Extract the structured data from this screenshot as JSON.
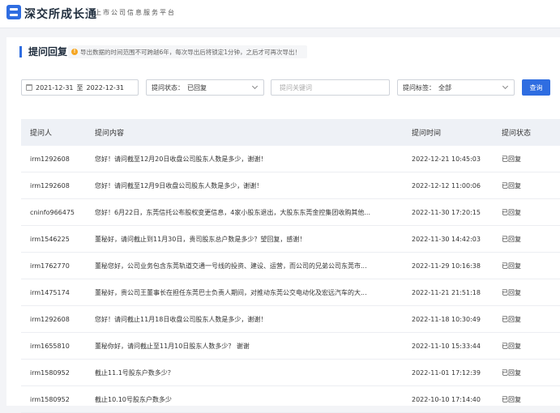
{
  "header": {
    "brand": "深交所成长通",
    "slogan": "上市公司信息服务平台"
  },
  "section": {
    "title": "提问回复",
    "notice": "导出数据的时间范围不可跨越6年，每次导出后将锁定1分钟，之后才可再次导出！"
  },
  "filters": {
    "date_start": "2021-12-31",
    "date_sep": "至",
    "date_end": "2022-12-31",
    "status_label": "提问状态：",
    "status_value": "已回复",
    "keyword_placeholder": "提问关键词",
    "tag_label": "提问标签：",
    "tag_value": "全部",
    "query_button": "查询"
  },
  "table": {
    "headers": [
      "提问人",
      "提问内容",
      "提问时间",
      "提问状态"
    ],
    "rows": [
      {
        "user": "irm1292608",
        "content": "您好！请问截至12月20日收盘公司股东人数是多少，谢谢！",
        "time": "2022-12-21 10:45:03",
        "status": "已回复"
      },
      {
        "user": "irm1292608",
        "content": "您好！请问截至12月9日收盘公司股东人数是多少，谢谢！",
        "time": "2022-12-12 11:00:06",
        "status": "已回复"
      },
      {
        "user": "cninfo966475",
        "content": "您好！6月22日，东莞信托公布股权变更信息，4家小股东退出，大股东东莞金控集团收购其他...",
        "time": "2022-11-30 17:20:15",
        "status": "已回复"
      },
      {
        "user": "irm1546225",
        "content": "董秘好，请问截止到11月30日，贵司股东总户数是多少？望回复，感谢！",
        "time": "2022-11-30 14:42:03",
        "status": "已回复"
      },
      {
        "user": "irm1762770",
        "content": "董秘您好，公司业务包含东莞轨道交通一号线的投资、建设、运营，而公司的兄弟公司东莞市...",
        "time": "2022-11-29 10:16:38",
        "status": "已回复"
      },
      {
        "user": "irm1475174",
        "content": "董秘好，贵公司王董事长在担任东莞巴士负责人期间，对推动东莞公交电动化及宏远汽车的大...",
        "time": "2022-11-21 21:51:18",
        "status": "已回复"
      },
      {
        "user": "irm1292608",
        "content": "您好！请问截止11月18日收盘公司股东人数是多少，谢谢！",
        "time": "2022-11-18 10:30:49",
        "status": "已回复"
      },
      {
        "user": "irm1655810",
        "content": "董秘你好，请问截止至11月10日股东人数多少？ 谢谢",
        "time": "2022-11-10 15:33:44",
        "status": "已回复"
      },
      {
        "user": "irm1580952",
        "content": "截止11.1号股东户数多少？",
        "time": "2022-11-01 17:12:39",
        "status": "已回复"
      },
      {
        "user": "irm1580952",
        "content": "截止10.10号股东户数多少",
        "time": "2022-10-10 17:14:40",
        "status": "已回复"
      }
    ]
  }
}
